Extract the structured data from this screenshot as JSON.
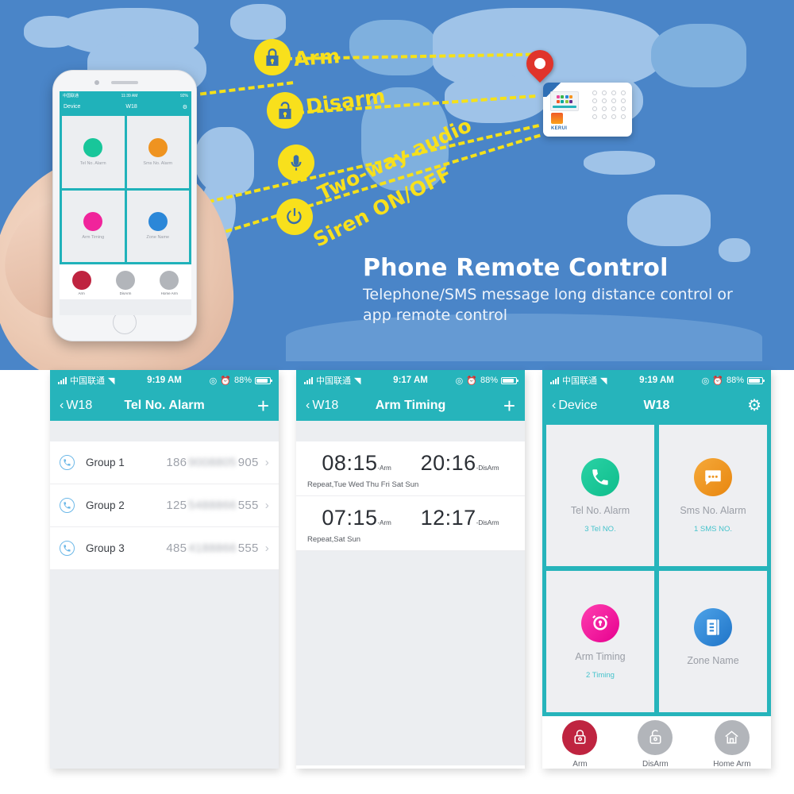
{
  "hero": {
    "title": "Phone Remote Control",
    "subtitle": "Telephone/SMS message long distance control or app remote control",
    "features": [
      {
        "label": "Arm",
        "icon": "lock-closed-icon"
      },
      {
        "label": "Disarm",
        "icon": "lock-open-icon"
      },
      {
        "label": "Two-way audio",
        "icon": "microphone-icon"
      },
      {
        "label": "Siren ON/OFF",
        "icon": "power-icon"
      }
    ],
    "device": {
      "brand": "KERUI",
      "pin": "location-pin-icon"
    },
    "phone_preview": {
      "status": {
        "carrier": "中国联通",
        "time": "11:39 AM",
        "battery": "92%"
      },
      "nav": {
        "back": "Device",
        "title": "W18"
      },
      "cards": [
        {
          "label": "Tel No. Alarm",
          "color": "#18c69a"
        },
        {
          "label": "Sms No. Alarm",
          "color": "#ef9320"
        },
        {
          "label": "Arm Timing",
          "color": "#f0249b"
        },
        {
          "label": "Zone Name",
          "color": "#2b87d8"
        }
      ],
      "bottom": [
        {
          "label": "Arm",
          "color": "#bf2440"
        },
        {
          "label": "DisArm",
          "color": "#b2b5ba"
        },
        {
          "label": "Home Arm",
          "color": "#b2b5ba"
        }
      ]
    }
  },
  "colors": {
    "teal": "#26b4bb",
    "map_ocean": "#4a85c8",
    "yellow": "#f8e01c"
  },
  "screens": [
    {
      "id": "tel-no-alarm",
      "status": {
        "carrier": "中国联通",
        "time": "9:19 AM",
        "battery": "88%"
      },
      "nav": {
        "back": "W18",
        "title": "Tel No. Alarm",
        "action": "+"
      },
      "rows": [
        {
          "label": "Group 1",
          "prefix": "186",
          "masked": "9008805",
          "suffix": "905"
        },
        {
          "label": "Group 2",
          "prefix": "125",
          "masked": "5488866",
          "suffix": "555"
        },
        {
          "label": "Group 3",
          "prefix": "485",
          "masked": "4188866",
          "suffix": "555"
        }
      ]
    },
    {
      "id": "arm-timing",
      "status": {
        "carrier": "中国联通",
        "time": "9:17 AM",
        "battery": "88%"
      },
      "nav": {
        "back": "W18",
        "title": "Arm Timing",
        "action": "+"
      },
      "timings": [
        {
          "arm_time": "08:15",
          "arm_suffix": "-Arm",
          "disarm_time": "20:16",
          "disarm_suffix": "-DisArm",
          "repeat": "Repeat,Tue Wed Thu Fri Sat Sun"
        },
        {
          "arm_time": "07:15",
          "arm_suffix": "-Arm",
          "disarm_time": "12:17",
          "disarm_suffix": "-DisArm",
          "repeat": "Repeat,Sat Sun"
        }
      ]
    },
    {
      "id": "device-w18",
      "status": {
        "carrier": "中国联通",
        "time": "9:19 AM",
        "battery": "88%"
      },
      "nav": {
        "back": "Device",
        "title": "W18",
        "action": "gear-icon"
      },
      "cards": [
        {
          "label": "Tel No. Alarm",
          "sub": "3 Tel NO.",
          "color": "#18c69a",
          "icon": "phone-icon"
        },
        {
          "label": "Sms No. Alarm",
          "sub": "1 SMS NO.",
          "color": "#ef9320",
          "icon": "message-icon"
        },
        {
          "label": "Arm Timing",
          "sub": "2 Timing",
          "color": "#f0249b",
          "icon": "alarm-clock-icon"
        },
        {
          "label": "Zone Name",
          "sub": "",
          "color": "#2b87d8",
          "icon": "document-icon"
        }
      ],
      "bottom": [
        {
          "label": "Arm",
          "color": "#bf2440",
          "icon": "lock-closed-icon"
        },
        {
          "label": "DisArm",
          "color": "#b2b5ba",
          "icon": "lock-open-icon"
        },
        {
          "label": "Home Arm",
          "color": "#b2b5ba",
          "icon": "home-icon"
        }
      ]
    }
  ]
}
